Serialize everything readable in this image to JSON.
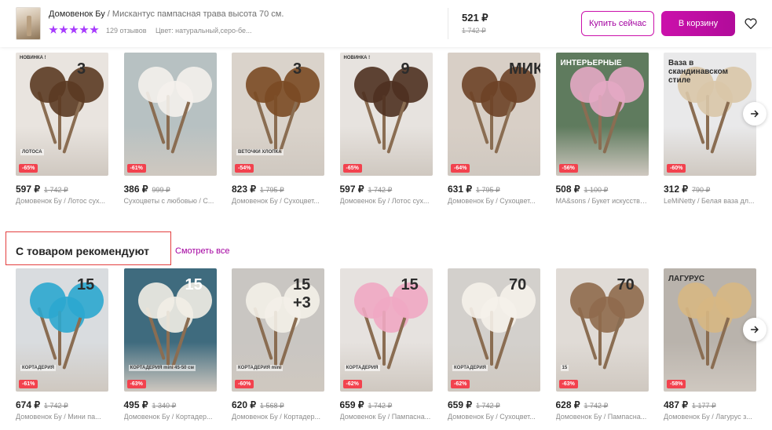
{
  "header": {
    "brand": "Домовенок Бу",
    "separator": " / ",
    "product_name": "Мискантус пампасная трава высота 70 см.",
    "rating_stars": 5,
    "reviews": "129 отзывов",
    "color_info": "Цвет: натуральный,серо-бе...",
    "price": "521 ₽",
    "old_price": "1 742 ₽",
    "buy_now_label": "Купить сейчас",
    "add_to_cart_label": "В корзину",
    "favorite_icon": "heart-icon"
  },
  "row1": {
    "cards": [
      {
        "price": "597 ₽",
        "old": "1 742 ₽",
        "title": "Домовенок Бу / Лотос сух...",
        "discount": "-65%",
        "overlay": "3",
        "overlay_sub": "ЛОТОСА",
        "tag": "НОВИНКА !",
        "bg": "#e9e4df",
        "accent": "#5b3a22"
      },
      {
        "price": "386 ₽",
        "old": "999 ₽",
        "title": "Сухоцветы с любовью / С...",
        "discount": "-61%",
        "overlay": "",
        "overlay_sub": "",
        "tag": "",
        "bg": "#b7c1c2",
        "accent": "#f4f1ec"
      },
      {
        "price": "823 ₽",
        "old": "1 795 ₽",
        "title": "Домовенок Бу / Сухоцвет...",
        "discount": "-54%",
        "overlay": "3",
        "overlay_sub": "ВЕТОЧКИ ХЛОПКА",
        "tag": "",
        "bg": "#dad3cb",
        "accent": "#7a4a24"
      },
      {
        "price": "597 ₽",
        "old": "1 742 ₽",
        "title": "Домовенок Бу / Лотос сух...",
        "discount": "-65%",
        "overlay": "9",
        "overlay_sub": "",
        "tag": "НОВИНКА !",
        "bg": "#e7e3df",
        "accent": "#4e3020"
      },
      {
        "price": "631 ₽",
        "old": "1 795 ₽",
        "title": "Домовенок Бу / Сухоцвет...",
        "discount": "-64%",
        "overlay": "МИКС",
        "overlay_sub": "",
        "tag": "",
        "bg": "#d8cfc6",
        "accent": "#6d4126"
      },
      {
        "price": "508 ₽",
        "old": "1 100 ₽",
        "title": "MA&sons / Букет искусстве...",
        "discount": "-56%",
        "overlay": "ИНТЕРЬЕРНЫЕ",
        "overlay_sub": "",
        "tag": "",
        "bg": "#5f7b5e",
        "accent": "#e4a8c4"
      },
      {
        "price": "312 ₽",
        "old": "790 ₽",
        "title": "LeMiNetty / Белая ваза дл...",
        "discount": "-60%",
        "overlay": "Ваза в скандинавском стиле",
        "overlay_sub": "",
        "tag": "",
        "bg": "#e9e9ea",
        "accent": "#d9c7a8"
      }
    ]
  },
  "section": {
    "title": "С товаром рекомендуют",
    "see_all": "Смотреть все"
  },
  "row2": {
    "cards": [
      {
        "price": "674 ₽",
        "old": "1 742 ₽",
        "title": "Домовенок Бу / Мини па...",
        "discount": "-61%",
        "overlay": "15",
        "overlay_sub": "КОРТАДЕРИЯ",
        "tag": "",
        "bg": "#d9dcdf",
        "accent": "#2ba7cf"
      },
      {
        "price": "495 ₽",
        "old": "1 340 ₽",
        "title": "Домовенок Бу / Кортадер...",
        "discount": "-63%",
        "overlay": "15",
        "overlay_sub": "КОРТАДЕРИЯ mini 45-50 см",
        "tag": "",
        "bg": "#3f6b7e",
        "accent": "#f2eee6"
      },
      {
        "price": "620 ₽",
        "old": "1 568 ₽",
        "title": "Домовенок Бу / Кортадер...",
        "discount": "-60%",
        "overlay": "15 +3",
        "overlay_sub": "КОРТАДЕРИЯ mini",
        "tag": "",
        "bg": "#c9c6c2",
        "accent": "#f3efe8"
      },
      {
        "price": "659 ₽",
        "old": "1 742 ₽",
        "title": "Домовенок Бу / Пампасна...",
        "discount": "-62%",
        "overlay": "15",
        "overlay_sub": "КОРТАДЕРИЯ",
        "tag": "",
        "bg": "#e6e2df",
        "accent": "#f0a9c3"
      },
      {
        "price": "659 ₽",
        "old": "1 742 ₽",
        "title": "Домовенок Бу / Сухоцвет...",
        "discount": "-62%",
        "overlay": "70",
        "overlay_sub": "КОРТАДЕРИЯ",
        "tag": "",
        "bg": "#d3d0cc",
        "accent": "#f5f1ea"
      },
      {
        "price": "628 ₽",
        "old": "1 742 ₽",
        "title": "Домовенок Бу / Пампасна...",
        "discount": "-63%",
        "overlay": "70",
        "overlay_sub": "15",
        "tag": "",
        "bg": "#e0dbd6",
        "accent": "#8f6a4c"
      },
      {
        "price": "487 ₽",
        "old": "1 177 ₽",
        "title": "Домовенок Бу / Лагурус з...",
        "discount": "-58%",
        "overlay": "ЛАГУРУС",
        "overlay_sub": "",
        "tag": "",
        "bg": "#b9b3ac",
        "accent": "#d7b783"
      }
    ]
  },
  "icons": {
    "next": "chevron-right-icon"
  }
}
